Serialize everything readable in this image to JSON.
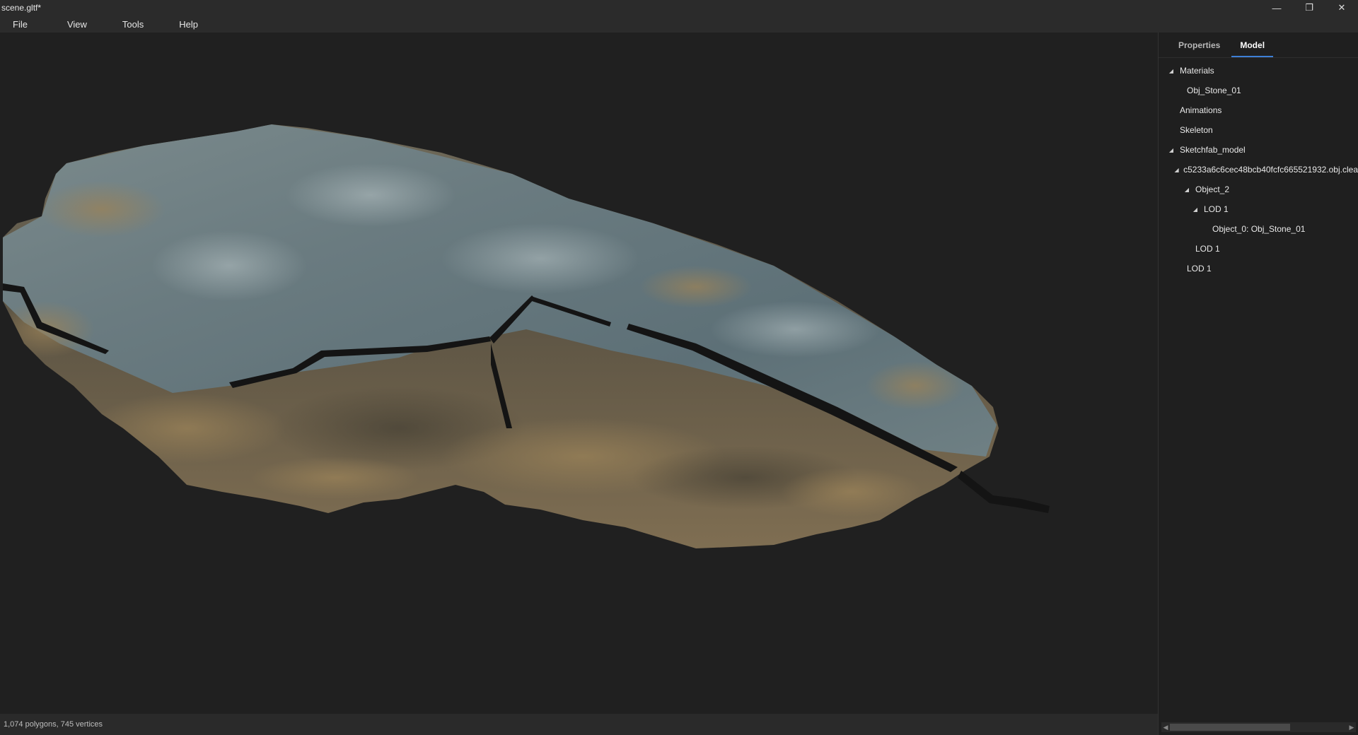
{
  "window": {
    "title": "scene.gltf*",
    "controls": {
      "minimize": "—",
      "restore": "❐",
      "close": "✕"
    }
  },
  "menu": {
    "file": "File",
    "view": "View",
    "tools": "Tools",
    "help": "Help"
  },
  "panel": {
    "tabs": [
      {
        "label": "Properties",
        "active": false
      },
      {
        "label": "Model",
        "active": true
      }
    ],
    "tree": [
      {
        "label": "Materials",
        "expanded": true,
        "depth": 0
      },
      {
        "label": "Obj_Stone_01",
        "depth": 1
      },
      {
        "label": "Animations",
        "depth": 0
      },
      {
        "label": "Skeleton",
        "depth": 0
      },
      {
        "label": "Sketchfab_model",
        "expanded": true,
        "depth": 0
      },
      {
        "label": "c5233a6c6cec48bcb40fcfc665521932.obj.clea",
        "expanded": true,
        "depth": 1
      },
      {
        "label": "Object_2",
        "expanded": true,
        "depth": 2
      },
      {
        "label": "LOD 1",
        "expanded": true,
        "depth": 3
      },
      {
        "label": "Object_0: Obj_Stone_01",
        "depth": 4
      },
      {
        "label": "LOD 1",
        "depth": 2
      },
      {
        "label": "LOD 1",
        "depth": 1
      }
    ]
  },
  "status": {
    "text": "1,074 polygons, 745 vertices"
  },
  "colors": {
    "background": "#202020",
    "accent": "#3d7fd6",
    "stone_gray": "#6f7e82",
    "stone_tan": "#8a7555"
  }
}
